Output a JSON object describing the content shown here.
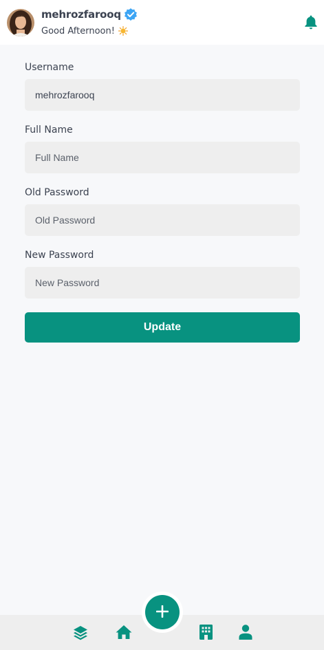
{
  "header": {
    "username": "mehrozfarooq",
    "greeting": "Good Afternoon!",
    "icons": {
      "verified": "verified-badge-icon",
      "greeting_emoji": "sun-icon",
      "notifications": "bell-icon"
    }
  },
  "form": {
    "username": {
      "label": "Username",
      "value": "mehrozfarooq",
      "placeholder": "Username"
    },
    "full_name": {
      "label": "Full Name",
      "value": "",
      "placeholder": "Full Name"
    },
    "old_password": {
      "label": "Old Password",
      "value": "",
      "placeholder": "Old Password"
    },
    "new_password": {
      "label": "New Password",
      "value": "",
      "placeholder": "New Password"
    },
    "submit_label": "Update"
  },
  "bottom_nav": {
    "items": [
      "layers-icon",
      "home-icon",
      "add-icon",
      "building-icon",
      "user-icon"
    ]
  },
  "colors": {
    "accent": "#089280",
    "text": "#3b4250",
    "input_bg": "#eeeeee",
    "page_bg": "#f7f8fa",
    "nav_bg": "#eeeeee"
  }
}
